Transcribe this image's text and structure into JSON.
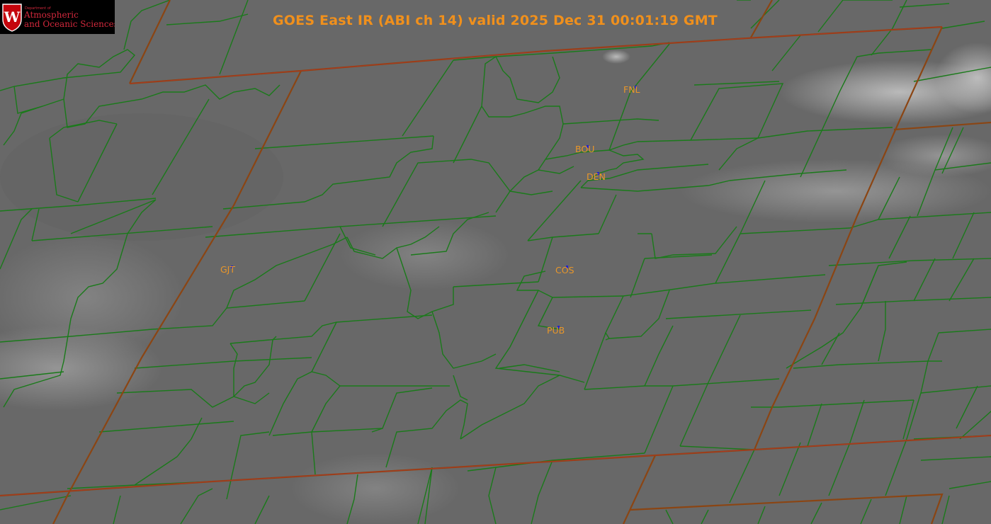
{
  "title": "GOES East IR (ABI ch 14) valid 2025 Dec 31 00:01:19 GMT",
  "logo": {
    "department": "Department of",
    "line1": "Atmospheric",
    "line2": "and Oceanic Sciences",
    "letter": "W"
  },
  "stations": [
    {
      "id": "FNL",
      "label": "FNL"
    },
    {
      "id": "BOU",
      "label": "BOU"
    },
    {
      "id": "DEN",
      "label": "DEN"
    },
    {
      "id": "GJT",
      "label": "GJT"
    },
    {
      "id": "COS",
      "label": "COS"
    },
    {
      "id": "PUB",
      "label": "PUB"
    }
  ],
  "colors": {
    "title": "#f0901c",
    "station_label": "#e8962a",
    "station_marker": "#2020d0",
    "state_border": "#8b4513",
    "county_border": "#1a7a1a",
    "logo_text": "#d2283c",
    "background": "#6a6a6a"
  }
}
